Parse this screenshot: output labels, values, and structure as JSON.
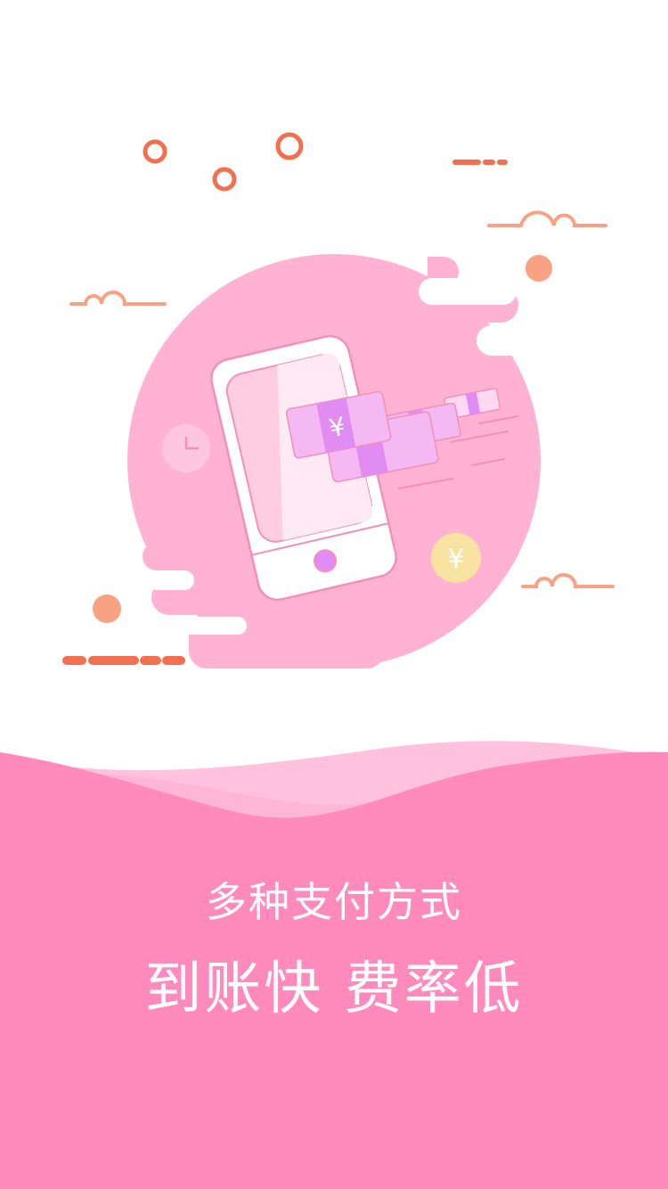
{
  "onboarding": {
    "subtitle": "多种支付方式",
    "headline": "到账快 费率低",
    "currency_symbol": "¥"
  },
  "colors": {
    "background": "#ffffff",
    "blob_pink": "#ffb2d2",
    "wave_pink": "#ff8abb",
    "wave_light": "#ffc4dc",
    "accent_coral": "#f2704f",
    "accent_salmon": "#f9a183",
    "money_violet": "#e08cf2",
    "money_light": "#f4b8f2",
    "coin_yellow": "#f7e2a2",
    "caption_text": "#ffffff"
  },
  "icons": [
    "ring-decoration-icon",
    "cloud-outline-icon",
    "dash-line-icon",
    "clock-icon",
    "coin-icon",
    "smartphone-icon",
    "banknote-icon"
  ]
}
